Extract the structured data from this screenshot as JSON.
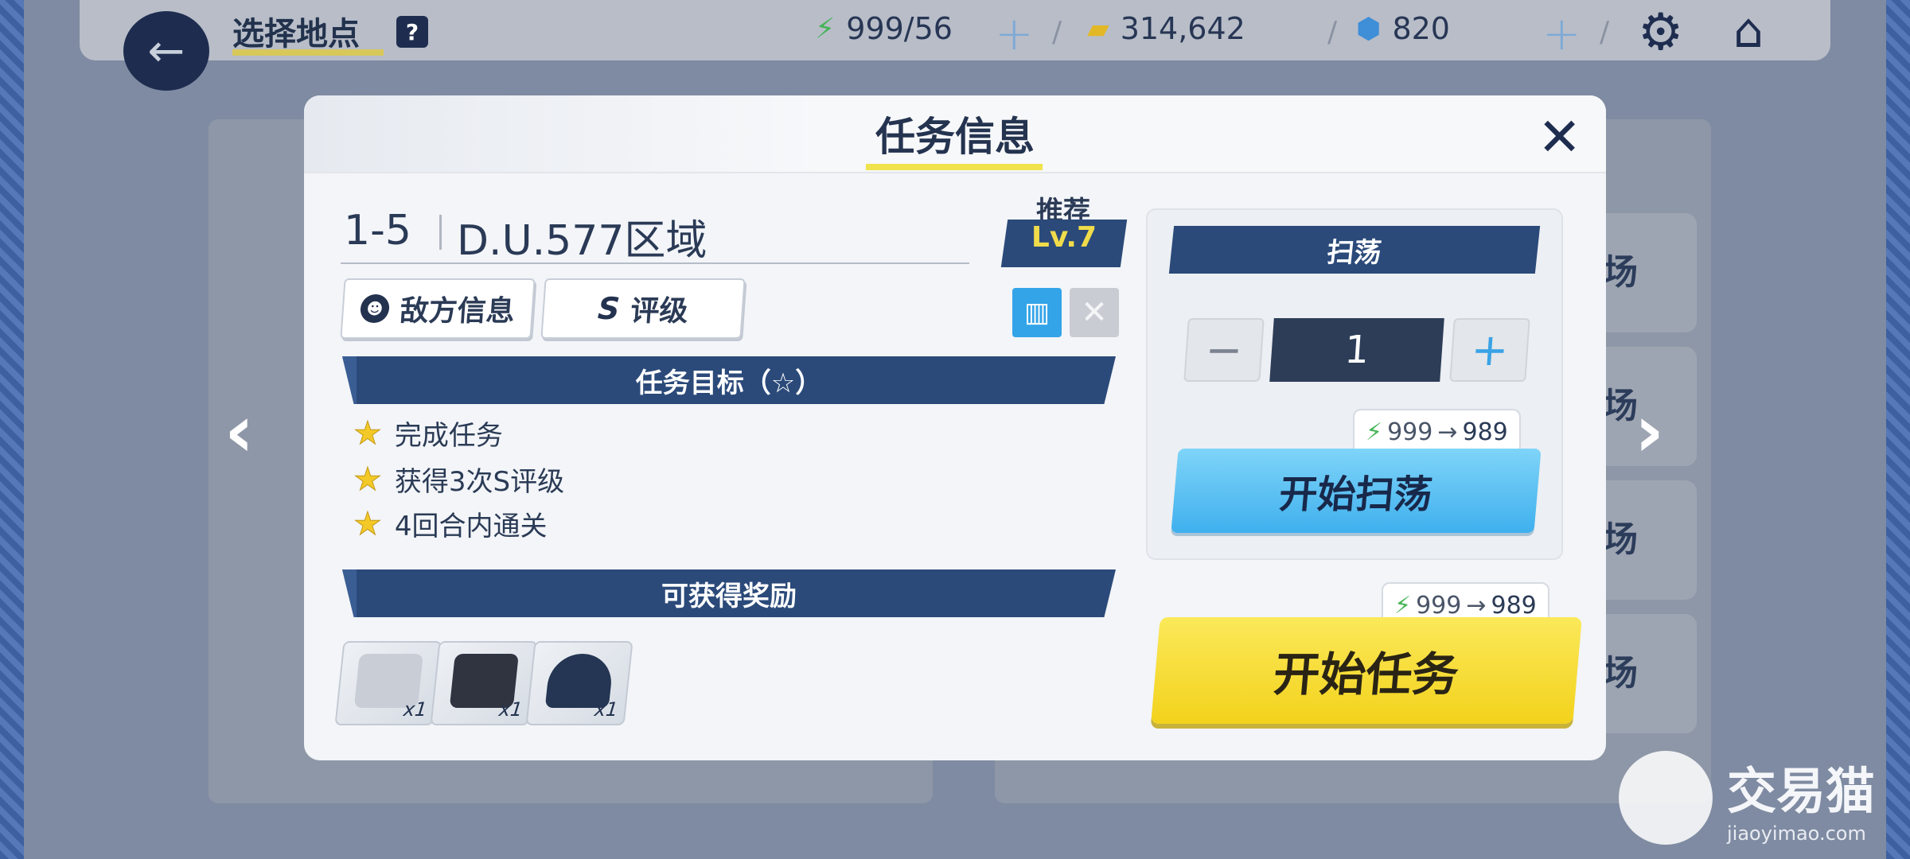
{
  "header": {
    "title": "选择地点",
    "help": "?",
    "energy": "999/56",
    "credits": "314,642",
    "gems": "820",
    "plus": "+"
  },
  "background": {
    "stage_labels": [
      "场",
      "场",
      "场",
      "场"
    ],
    "nav_prev": "‹",
    "nav_next": "›"
  },
  "modal": {
    "title": "任务信息",
    "stage_id": "1-5",
    "stage_name": "D.U.577区域",
    "recommend_label": "推荐",
    "recommend_level": "Lv.7",
    "tabs": {
      "enemy": "敌方信息",
      "rank_mark": "S",
      "rank": "评级"
    },
    "objectives_title": "任务目标（☆）",
    "objectives": [
      "完成任务",
      "获得3次S评级",
      "4回合内通关"
    ],
    "rewards_title": "可获得奖励",
    "rewards": [
      {
        "count": "x1",
        "color": "#c9ced6"
      },
      {
        "count": "x1",
        "color": "#2f3440"
      },
      {
        "count": "x1",
        "color": "#253654"
      }
    ],
    "sweep": {
      "title": "扫荡",
      "minus": "−",
      "quantity": "1",
      "plus": "+",
      "cost_from": "999",
      "cost_arrow": "→",
      "cost_to": "989",
      "button": "开始扫荡"
    },
    "start": {
      "cost_from": "999",
      "cost_arrow": "→",
      "cost_to": "989",
      "button": "开始任务"
    }
  },
  "watermark": {
    "name": "交易猫",
    "url": "jiaoyimao.com"
  }
}
